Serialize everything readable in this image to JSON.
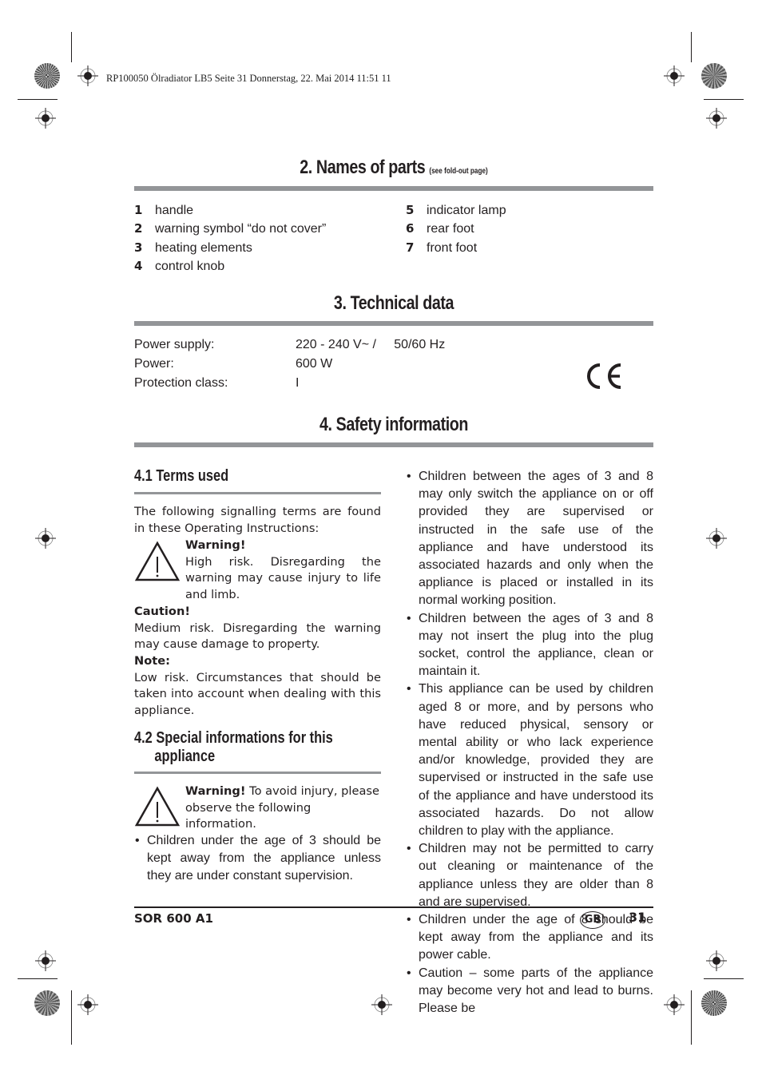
{
  "print_header": "RP100050 Ölradiator LB5  Seite 31  Donnerstag, 22. Mai 2014  11:51 11",
  "section2": {
    "title": "2. Names of parts",
    "note": "(see fold-out page)",
    "parts_left": [
      {
        "num": "1",
        "label": "handle"
      },
      {
        "num": "2",
        "label": "warning symbol “do not cover”"
      },
      {
        "num": "3",
        "label": "heating elements"
      },
      {
        "num": "4",
        "label": "control knob"
      }
    ],
    "parts_right": [
      {
        "num": "5",
        "label": "indicator lamp"
      },
      {
        "num": "6",
        "label": "rear foot"
      },
      {
        "num": "7",
        "label": "front foot"
      }
    ]
  },
  "section3": {
    "title": "3. Technical data",
    "rows": [
      {
        "key": "Power supply:",
        "value": "220 - 240 V~ /     50/60 Hz"
      },
      {
        "key": "Power:",
        "value": "600 W"
      },
      {
        "key": "Protection class:",
        "value": "I"
      }
    ],
    "mark": "CE"
  },
  "section4": {
    "title": "4. Safety information",
    "sub1": {
      "title": "4.1 Terms used",
      "intro": "The following signalling terms are found in these Operating Instructions:",
      "warning_label": "Warning!",
      "warning_text": "High risk. Disregarding the warning may cause injury to life and limb.",
      "caution_label": "Caution!",
      "caution_text": "Medium risk. Disregarding the warning may cause damage to property.",
      "note_label": "Note:",
      "note_text": "Low risk. Circumstances that should be taken into account when dealing with this appliance."
    },
    "sub2": {
      "title_line1": "4.2 Special informations for this",
      "title_line2": "appliance",
      "warning_label": "Warning!",
      "warning_text": " To avoid injury, please observe the following information.",
      "bullets_left": [
        "Children under the age of 3 should be kept away from the appliance unless they are under constant supervision."
      ]
    },
    "bullets_right": [
      "Children between the ages of 3 and 8 may only switch the appliance on or off provided they are supervised or instructed in the safe use of the appliance and have understood its associated hazards and only when the appliance is placed or installed in its normal working position.",
      "Children between the ages of 3 and 8 may not insert the plug into the plug socket, control the appliance, clean or maintain it.",
      "This appliance can be used by children aged 8 or more, and by persons who have reduced physical, sensory or mental ability or who lack experience and/or knowledge, provided they are supervised or instructed in the safe use of the appliance and have understood its associated hazards. Do not allow children to play with the appliance.",
      "Children may not be permitted to carry out cleaning or maintenance of the appliance unless they are older than 8 and are supervised.",
      "Children under the age of 8 should be kept away from the appliance and its power cable.",
      "Caution – some parts of the appliance may become very hot and lead to burns. Please be"
    ]
  },
  "footer": {
    "model": "SOR 600 A1",
    "country": "GB",
    "page": "31"
  },
  "icons": {
    "warning": "warning-triangle-icon",
    "registration": "registration-mark-icon",
    "color_bar": "color-rosette-icon"
  },
  "colors": {
    "text": "#231f20",
    "separator": "#939598"
  }
}
